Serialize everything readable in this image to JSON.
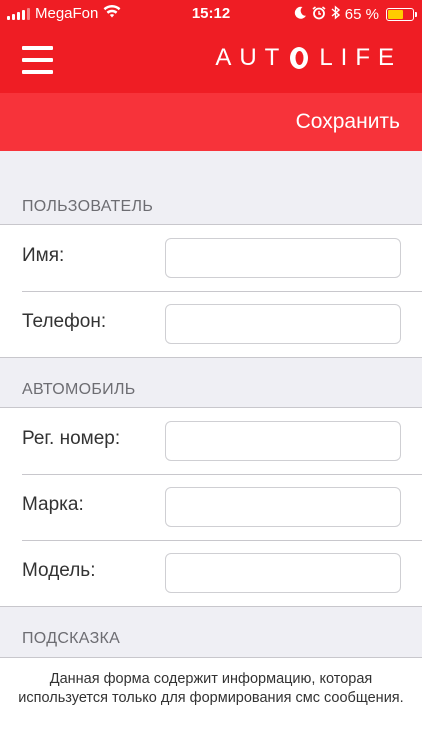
{
  "status_bar": {
    "carrier": "MegaFon",
    "time": "15:12",
    "battery_text": "65 %",
    "battery_level": 0.65,
    "icons": [
      "signal-icon",
      "wifi-icon",
      "moon-icon",
      "alarm-icon",
      "bluetooth-icon",
      "battery-icon"
    ]
  },
  "header": {
    "logo_text_left": "AUT",
    "logo_text_right": "LIFE",
    "menu_icon": "hamburger-menu-icon",
    "background": "#ef1d24"
  },
  "toolbar": {
    "save_label": "Сохранить",
    "background": "#f7333a"
  },
  "sections": {
    "user": {
      "title": "ПОЛЬЗОВАТЕЛЬ",
      "fields": {
        "name_label": "Имя:",
        "name_value": "",
        "phone_label": "Телефон:",
        "phone_value": ""
      }
    },
    "car": {
      "title": "АВТОМОБИЛЬ",
      "fields": {
        "reg_label": "Рег. номер:",
        "reg_value": "",
        "brand_label": "Марка:",
        "brand_value": "",
        "model_label": "Модель:",
        "model_value": ""
      }
    },
    "hint": {
      "title": "ПОДСКАЗКА",
      "text": "Данная форма содержит информацию, которая используется только для формирования смс сообщения."
    }
  }
}
